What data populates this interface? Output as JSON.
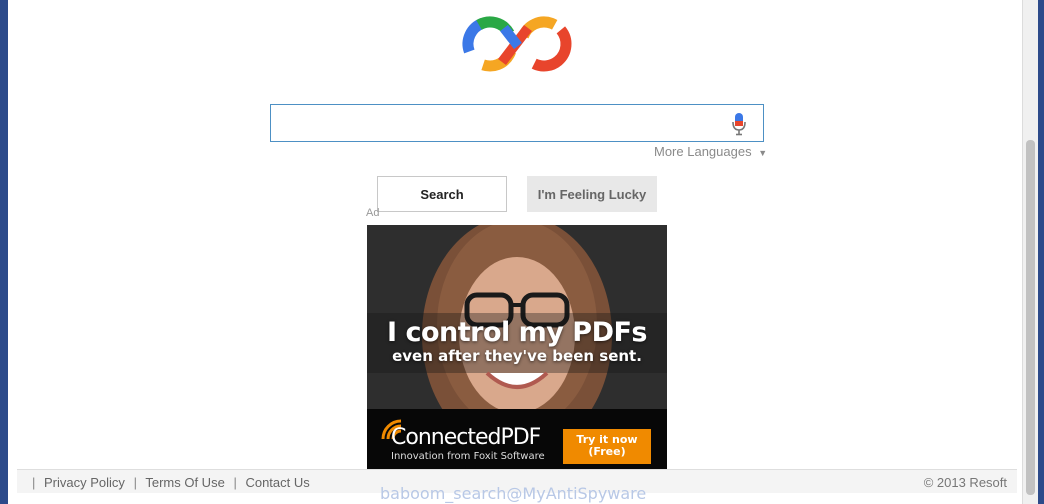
{
  "search": {
    "value": "",
    "placeholder": "",
    "more_languages": "More Languages",
    "more_languages_arrow": "▼",
    "search_button": "Search",
    "lucky_button": "I'm Feeling Lucky"
  },
  "ad": {
    "label": "Ad",
    "headline": "I control my PDFs",
    "subline": "even after they've been sent.",
    "brand": "ConnectedPDF",
    "tagline": "Innovation from Foxit Software",
    "cta_line1": "Try it now",
    "cta_line2": "(Free)"
  },
  "footer": {
    "links": [
      "Privacy Policy",
      "Terms Of Use",
      "Contact Us"
    ],
    "separator": "|",
    "copyright": "© 2013 Resoft"
  },
  "watermark": "baboom_search@MyAntiSpyware",
  "colors": {
    "logo_blue": "#3b78e7",
    "logo_red": "#e8452c",
    "logo_yellow": "#f5a623",
    "logo_green": "#2aa845",
    "search_border": "#4d90c4",
    "cta": "#f08a00",
    "page_frame": "#2c4a8a"
  }
}
